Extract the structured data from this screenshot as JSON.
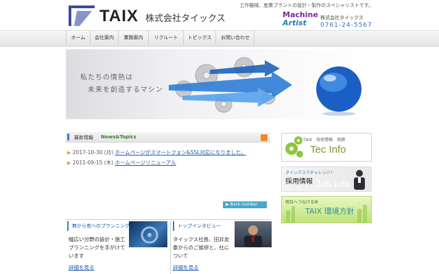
{
  "header": {
    "tagline": "工作機械、産業プラントの設計・製作のスペシャリストです。",
    "logo_text": "TAIX",
    "company_name": "株式会社タイックス",
    "badge_line1": "Machine",
    "badge_line2": "Artist",
    "company_small": "株式会社タイックス",
    "phone": "0761-24-5567"
  },
  "nav": [
    "ホーム",
    "会社案内",
    "業務案内",
    "リクルート",
    "トピックス",
    "お問い合わせ"
  ],
  "hero": {
    "line1": "私たちの情熱は",
    "line2": "未来を創造するマシン"
  },
  "news": {
    "title": "最新情報",
    "title_en": "News&Topics",
    "items": [
      {
        "date": "2017-10-30 (月)",
        "text": "ホームページがスマートフォン&SSL対応になりました。"
      },
      {
        "date": "2011-09-15 (木)",
        "text": "ホームページリニューアル"
      }
    ],
    "back_label": "Back number"
  },
  "banners": {
    "tec_small": "TAIX　技術情報　実績",
    "tec_big": "Tec Info",
    "job_small": "タイックスでチャレンジ！",
    "job_big": "採用情報",
    "job_ghost": "Job Info",
    "env_small": "明日へつなげる命",
    "env_big": "TAIX 環境方針"
  },
  "blocks": {
    "left": {
      "title": "無から有へのプランニング",
      "text_line1": "幅広い分野の設計・施工",
      "text_line2": "プランニングを手がけて",
      "text_line3": "います",
      "link": "詳細を見る"
    },
    "right": {
      "title": "トップインタビュー",
      "text_line1": "タイックス社長、田井友",
      "text_line2": "泰からのご挨拶と、社に",
      "text_line3": "ついて",
      "link": "詳細を見る"
    }
  }
}
